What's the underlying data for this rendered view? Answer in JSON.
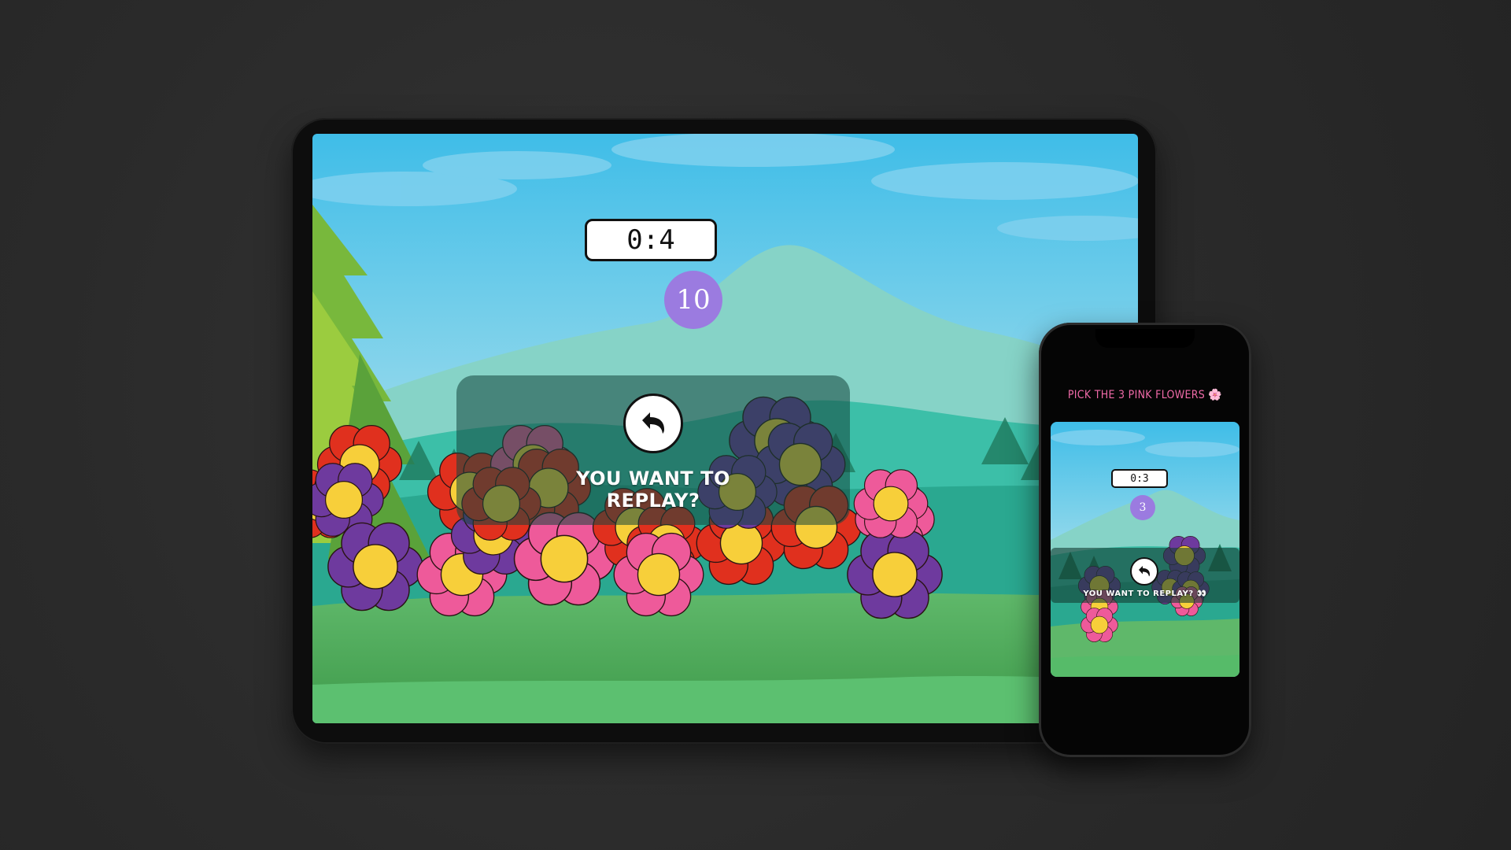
{
  "tablet": {
    "timer": "0:4",
    "score": "10",
    "replay_prompt": "YOU WANT TO REPLAY?"
  },
  "phone": {
    "title": "PICK THE 3 PINK FLOWERS 🌸",
    "timer": "0:3",
    "score": "3",
    "replay_prompt": "YOU WANT TO REPLAY? 👀"
  },
  "icons": {
    "replay": "undo-arrow-icon",
    "flower": "flower-icon"
  },
  "colors": {
    "sky_top": "#4fc3ea",
    "sky_bottom": "#a9e2ee",
    "score_badge": "#9b7be0",
    "flower_red": "#e0301e",
    "flower_purple": "#6e3a9e",
    "flower_pink": "#ee5a9a",
    "flower_center": "#f7cf3a",
    "title_pink": "#f06aa8"
  }
}
